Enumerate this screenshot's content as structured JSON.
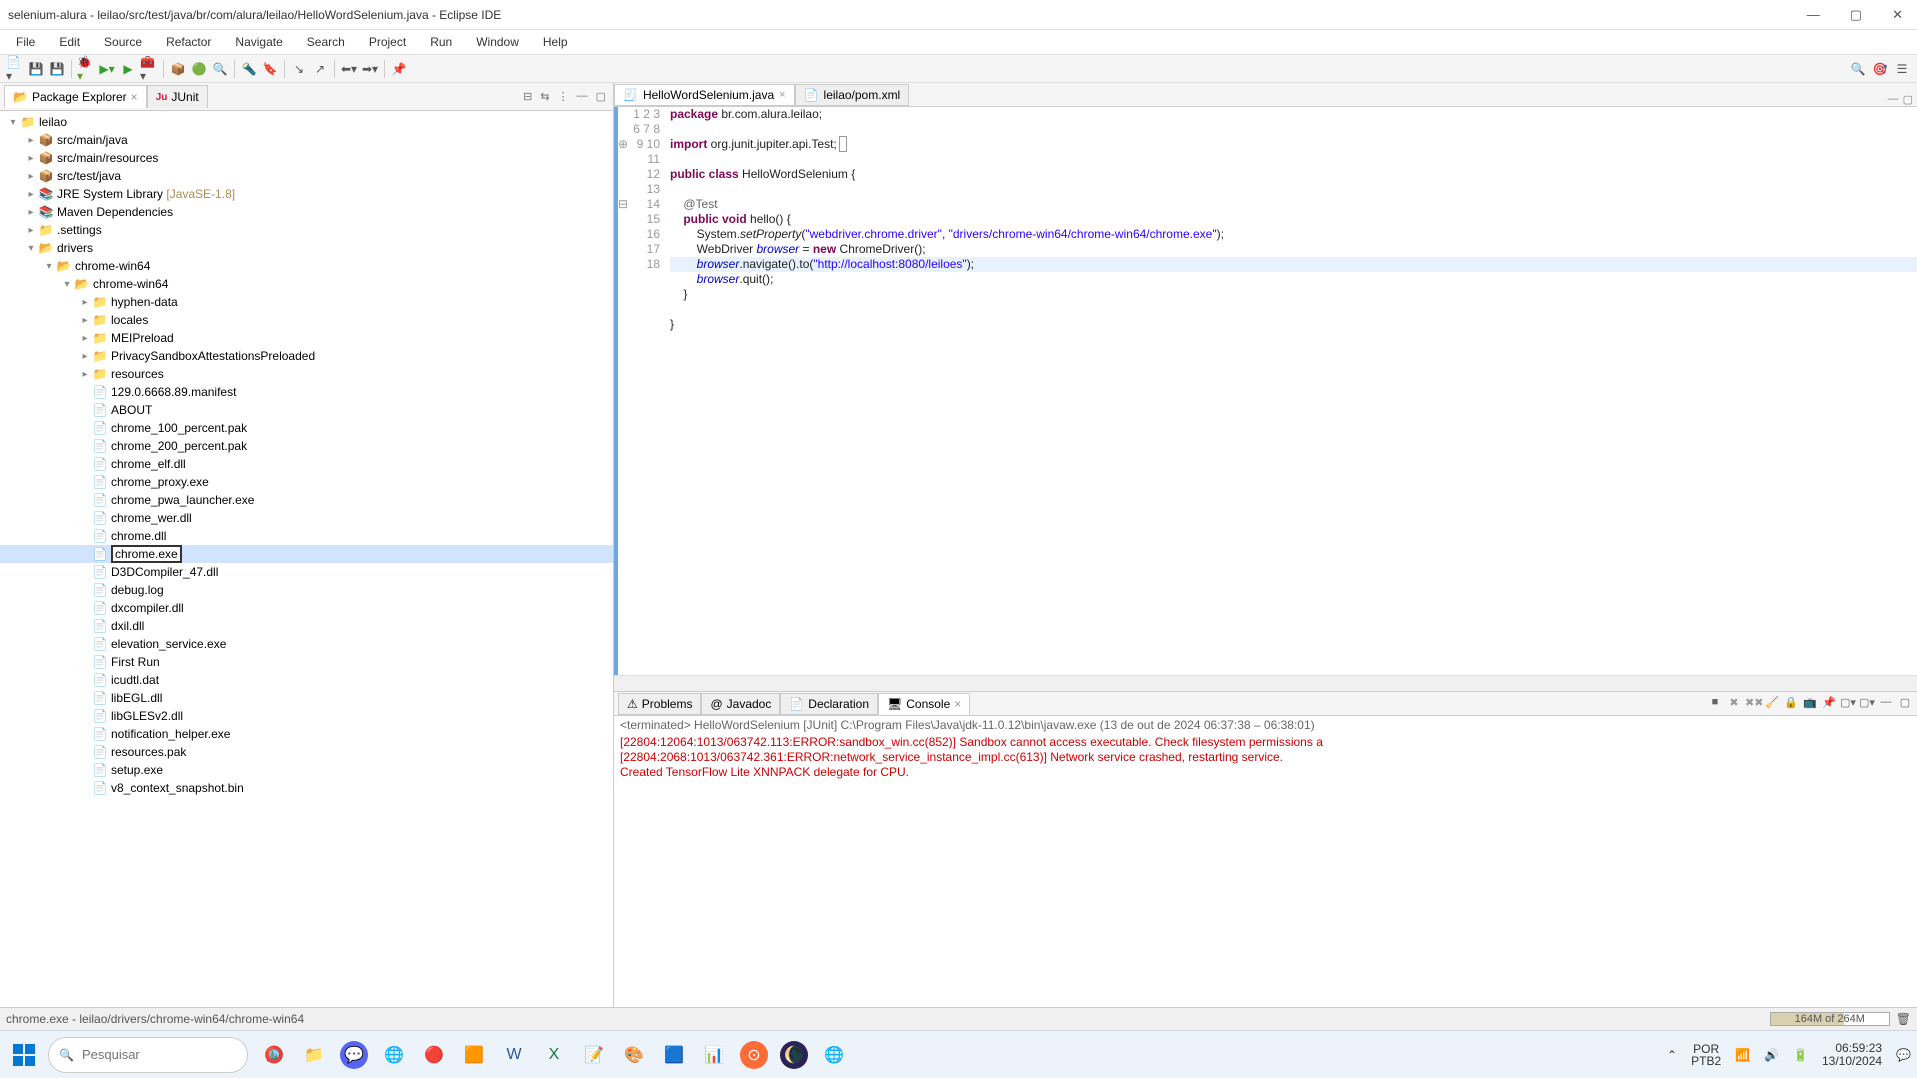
{
  "window": {
    "title": "selenium-alura - leilao/src/test/java/br/com/alura/leilao/HelloWordSelenium.java - Eclipse IDE"
  },
  "menubar": [
    "File",
    "Edit",
    "Source",
    "Refactor",
    "Navigate",
    "Search",
    "Project",
    "Run",
    "Window",
    "Help"
  ],
  "left_panel": {
    "tabs": [
      {
        "label": "Package Explorer",
        "icon": "📁"
      },
      {
        "label": "JUnit",
        "icon": "Ju"
      }
    ],
    "project": "leilao",
    "src_main_java": "src/main/java",
    "src_main_resources": "src/main/resources",
    "src_test_java": "src/test/java",
    "jre": "JRE System Library",
    "jre_hint": "[JavaSE-1.8]",
    "maven_deps": "Maven Dependencies",
    "settings": ".settings",
    "drivers": "drivers",
    "chrome_win64_a": "chrome-win64",
    "chrome_win64_b": "chrome-win64",
    "sub_folders": [
      "hyphen-data",
      "locales",
      "MEIPreload",
      "PrivacySandboxAttestationsPreloaded",
      "resources"
    ],
    "files": [
      "129.0.6668.89.manifest",
      "ABOUT",
      "chrome_100_percent.pak",
      "chrome_200_percent.pak",
      "chrome_elf.dll",
      "chrome_proxy.exe",
      "chrome_pwa_launcher.exe",
      "chrome_wer.dll",
      "chrome.dll",
      "chrome.exe",
      "D3DCompiler_47.dll",
      "debug.log",
      "dxcompiler.dll",
      "dxil.dll",
      "elevation_service.exe",
      "First Run",
      "icudtl.dat",
      "libEGL.dll",
      "libGLESv2.dll",
      "notification_helper.exe",
      "resources.pak",
      "setup.exe",
      "v8_context_snapshot.bin"
    ],
    "selected_file": "chrome.exe"
  },
  "editor": {
    "tabs": [
      {
        "label": "HelloWordSelenium.java",
        "active": true
      },
      {
        "label": "leilao/pom.xml",
        "active": false
      }
    ],
    "code_lines": {
      "l1": "package br.com.alura.leilao;",
      "l3": "import org.junit.jupiter.api.Test;",
      "l7": "public class HelloWordSelenium {",
      "l9": "    @Test",
      "l10": "    public void hello() {",
      "l11": "        System.setProperty(\"webdriver.chrome.driver\", \"drivers/chrome-win64/chrome-win64/chrome.exe\");",
      "l12": "        WebDriver browser = new ChromeDriver();",
      "l13": "        browser.navigate().to(\"http://localhost:8080/leiloes\");",
      "l14": "        browser.quit();",
      "l15": "    }",
      "l17": "}"
    }
  },
  "console": {
    "tabs": [
      "Problems",
      "Javadoc",
      "Declaration",
      "Console"
    ],
    "header": "<terminated> HelloWordSelenium [JUnit] C:\\Program Files\\Java\\jdk-11.0.12\\bin\\javaw.exe  (13 de out de 2024 06:37:38 – 06:38:01)",
    "line1": "[22804:12064:1013/063742.113:ERROR:sandbox_win.cc(852)] Sandbox cannot access executable. Check filesystem permissions a",
    "line2": "[22804:2068:1013/063742.361:ERROR:network_service_instance_impl.cc(613)] Network service crashed, restarting service.",
    "line3": "Created TensorFlow Lite XNNPACK delegate for CPU."
  },
  "statusbar": {
    "path": "chrome.exe - leilao/drivers/chrome-win64/chrome-win64",
    "heap": "164M of 264M"
  },
  "taskbar": {
    "search_placeholder": "Pesquisar",
    "lang": "POR",
    "kbd": "PTB2",
    "time": "06:59:23",
    "date": "13/10/2024"
  }
}
